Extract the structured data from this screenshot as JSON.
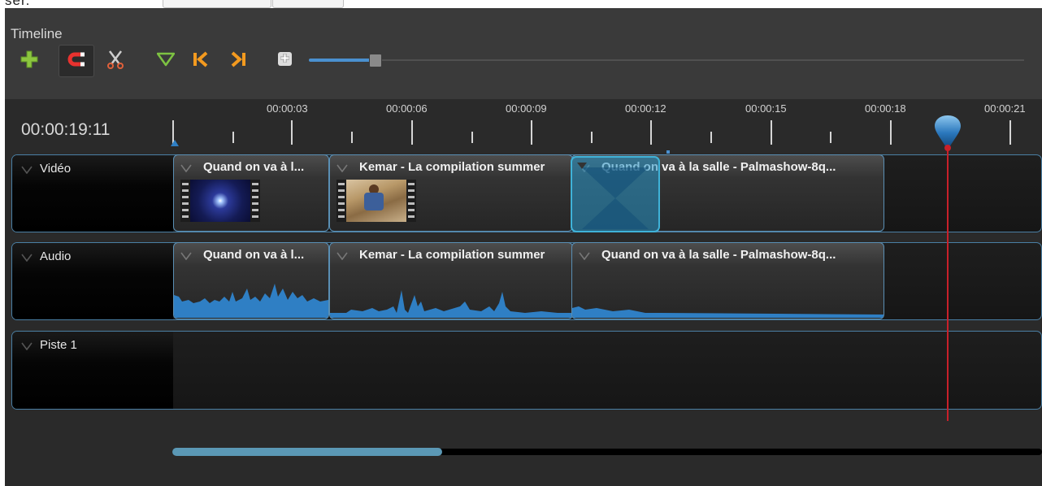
{
  "top_clip": {
    "cut_text": "ser."
  },
  "panel": {
    "title": "Timeline",
    "time_display": "00:00:19:11"
  },
  "toolbar": {
    "buttons": [
      {
        "name": "add-track",
        "icon": "plus-icon"
      },
      {
        "name": "snapping",
        "icon": "magnet-icon",
        "active": true
      },
      {
        "name": "razor",
        "icon": "scissors-icon"
      },
      {
        "name": "add-marker",
        "icon": "marker-icon"
      },
      {
        "name": "previous-marker",
        "icon": "previous-marker-icon"
      },
      {
        "name": "next-marker",
        "icon": "next-marker-icon"
      }
    ],
    "zoom_level": 0.09
  },
  "ruler": {
    "labels": [
      "00:00:03",
      "00:00:06",
      "00:00:09",
      "00:00:12",
      "00:00:15",
      "00:00:18",
      "00:00:21"
    ]
  },
  "tracks": [
    {
      "label": "Vidéo",
      "clips": [
        {
          "title": "Quand on va à l..."
        },
        {
          "title": "Kemar - La compilation summer"
        },
        {
          "title": "Quand on va à la salle - Palmashow-8q..."
        }
      ]
    },
    {
      "label": "Audio",
      "clips": [
        {
          "title": "Quand on va à l..."
        },
        {
          "title": "Kemar - La compilation summer"
        },
        {
          "title": "Quand on va à la salle - Palmashow-8q..."
        }
      ]
    },
    {
      "label": "Piste 1",
      "clips": []
    }
  ],
  "colors": {
    "accent": "#4a90d0",
    "playhead": "#c8202a",
    "waveform": "#2f7fc4",
    "clip_border": "#5a8fb4"
  },
  "scroll_position": 0.31
}
